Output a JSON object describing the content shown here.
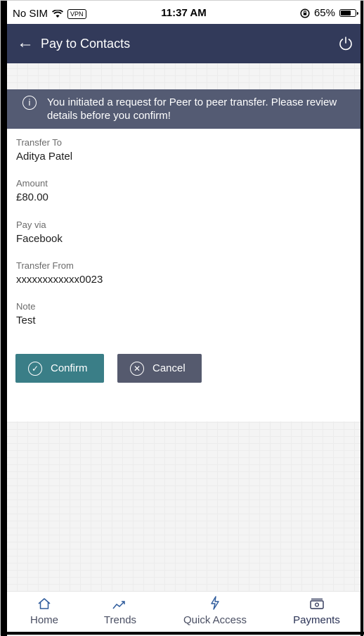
{
  "status_bar": {
    "carrier": "No SIM",
    "vpn": "VPN",
    "time": "11:37 AM",
    "battery": "65%",
    "battery_level": 0.65
  },
  "header": {
    "title": "Pay to Contacts"
  },
  "banner": {
    "message": "You initiated a request for Peer to peer transfer. Please review details before you confirm!"
  },
  "details": [
    {
      "label": "Transfer To",
      "value": "Aditya Patel"
    },
    {
      "label": "Amount",
      "value": "£80.00"
    },
    {
      "label": "Pay via",
      "value": "Facebook"
    },
    {
      "label": "Transfer From",
      "value": "xxxxxxxxxxxx0023"
    },
    {
      "label": "Note",
      "value": "Test"
    }
  ],
  "actions": {
    "confirm": "Confirm",
    "cancel": "Cancel"
  },
  "nav": {
    "items": [
      {
        "label": "Home",
        "icon": "home-icon"
      },
      {
        "label": "Trends",
        "icon": "trends-icon"
      },
      {
        "label": "Quick Access",
        "icon": "lightning-icon"
      },
      {
        "label": "Payments",
        "icon": "payments-icon",
        "active": true
      }
    ]
  },
  "colors": {
    "header": "#323a5a",
    "banner": "#545b73",
    "confirm": "#3a7e87",
    "cancel": "#555a6e",
    "nav_active_underline": "#2e5b9c"
  }
}
